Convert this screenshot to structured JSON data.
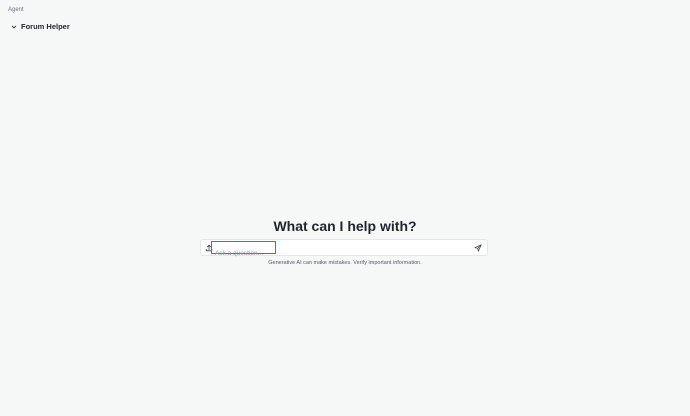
{
  "header": {
    "section_label": "Agent",
    "agent_name": "Forum Helper"
  },
  "main": {
    "headline": "What can I help with?",
    "composer": {
      "placeholder": "Ask a question...",
      "value": ""
    },
    "disclaimer": "Generative AI can make mistakes. Verify important information."
  },
  "icons": {
    "agent_toggle": "chevron-down-icon",
    "attach": "upload-icon",
    "send": "send-icon"
  },
  "colors": {
    "background": "#f6f7f7",
    "focus_outline": "#e03c3c"
  }
}
